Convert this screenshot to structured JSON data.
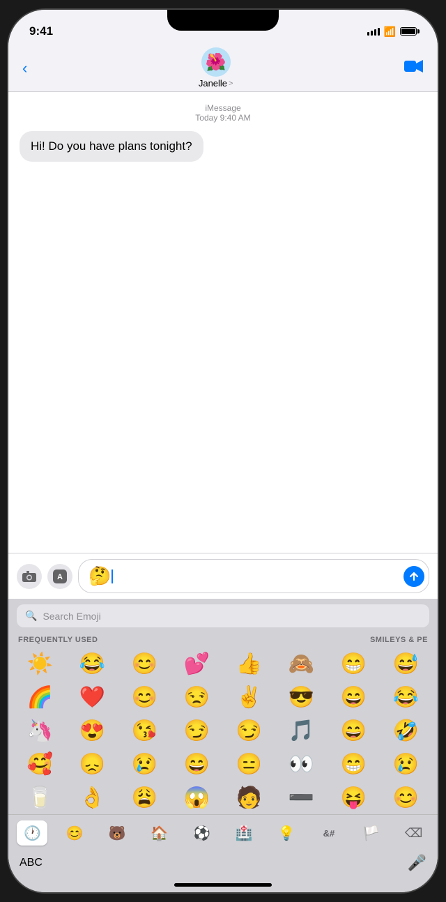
{
  "statusBar": {
    "time": "9:41",
    "battery": "full"
  },
  "navBar": {
    "backLabel": "<",
    "contactName": "Janelle",
    "chevron": ">",
    "avatarEmoji": "🌺",
    "videoIcon": "📹"
  },
  "messageMeta": {
    "service": "iMessage",
    "timestamp": "Today 9:40 AM"
  },
  "messages": [
    {
      "text": "Hi! Do you have plans tonight?",
      "sender": "them"
    }
  ],
  "inputArea": {
    "currentEmoji": "🤔",
    "cameraIcon": "📷",
    "appIcon": "A",
    "sendIcon": "↑"
  },
  "emojiKeyboard": {
    "searchPlaceholder": "Search Emoji",
    "sectionLeft": "FREQUENTLY USED",
    "sectionRight": "SMILEYS & PE",
    "frequentlyUsed": [
      [
        "☀️",
        "😂",
        "😊",
        "💕",
        "👍",
        "🙈",
        "😁",
        "😅"
      ],
      [
        "🌈",
        "❤️",
        "😊",
        "😒",
        "✌️",
        "😎",
        "😄",
        "😂"
      ],
      [
        "🦄",
        "😍",
        "😘",
        "😏",
        "😏",
        "🎵",
        "😄",
        "🤣"
      ],
      [
        "🥰",
        "😞",
        "😢",
        "😄",
        "😑",
        "👀",
        "😁",
        "😢"
      ],
      [
        "🥛",
        "👌",
        "😩",
        "😱",
        "🧑",
        "➖",
        "😝",
        "😊"
      ]
    ],
    "tabs": [
      {
        "icon": "🕐",
        "type": "recent",
        "active": true
      },
      {
        "icon": "😊",
        "type": "smileys"
      },
      {
        "icon": "🐻",
        "type": "animals"
      },
      {
        "icon": "🏠",
        "type": "objects"
      },
      {
        "icon": "⚽",
        "type": "activities"
      },
      {
        "icon": "🏥",
        "type": "places"
      },
      {
        "icon": "💡",
        "type": "symbols"
      },
      {
        "icon": "🔣",
        "type": "extra"
      },
      {
        "icon": "🏳️",
        "type": "flags"
      },
      {
        "icon": "⌫",
        "type": "delete"
      }
    ],
    "bottomBar": {
      "abcLabel": "ABC",
      "micIcon": "🎤"
    }
  }
}
